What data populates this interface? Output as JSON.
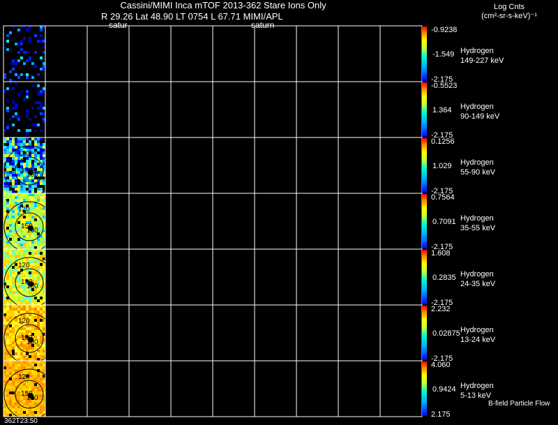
{
  "header": {
    "title": "Cassini/MIMI Inca mTOF  2013-362   Stare   Ions Only",
    "ephemeris": "R       29.26 Lat 48.90 LT 0754 L        67.71  MIMI/APL",
    "saturn_label_1": "satur",
    "saturn_label_2": "saturn",
    "units_line1": "Log Cnts",
    "units_line2": "(cm²-sr-s-keV)⁻¹"
  },
  "time_label": "362T23:50",
  "footnote": "B-field Particle Flow",
  "contour_labels": [
    "120",
    "150",
    "180"
  ],
  "chart_data": [
    {
      "type": "heatmap",
      "species": "Hydrogen",
      "energy": "149-227 keV",
      "colorbar": {
        "max": "-0.9238",
        "mid": "-1.549",
        "min": "-2.175"
      }
    },
    {
      "type": "heatmap",
      "species": "Hydrogen",
      "energy": "90-149 keV",
      "colorbar": {
        "max": "-0.5523",
        "mid": "1.364",
        "min": "-2.175"
      }
    },
    {
      "type": "heatmap",
      "species": "Hydrogen",
      "energy": "55-90 keV",
      "colorbar": {
        "max": "0.1256",
        "mid": "1.029",
        "min": "-2.175"
      }
    },
    {
      "type": "heatmap",
      "species": "Hydrogen",
      "energy": "35-55 keV",
      "colorbar": {
        "max": "0.7564",
        "mid": "0.7091",
        "min": "-2.175"
      }
    },
    {
      "type": "heatmap",
      "species": "Hydrogen",
      "energy": "24-35 keV",
      "colorbar": {
        "max": "1.608",
        "mid": "0.2835",
        "min": "-2.175"
      }
    },
    {
      "type": "heatmap",
      "species": "Hydrogen",
      "energy": "13-24 keV",
      "colorbar": {
        "max": "2.232",
        "mid": "0.02875",
        "min": "-2.175"
      }
    },
    {
      "type": "heatmap",
      "species": "Hydrogen",
      "energy": "5-13 keV",
      "colorbar": {
        "max": "4.060",
        "mid": "0.9424",
        "min": "2.175"
      }
    }
  ]
}
